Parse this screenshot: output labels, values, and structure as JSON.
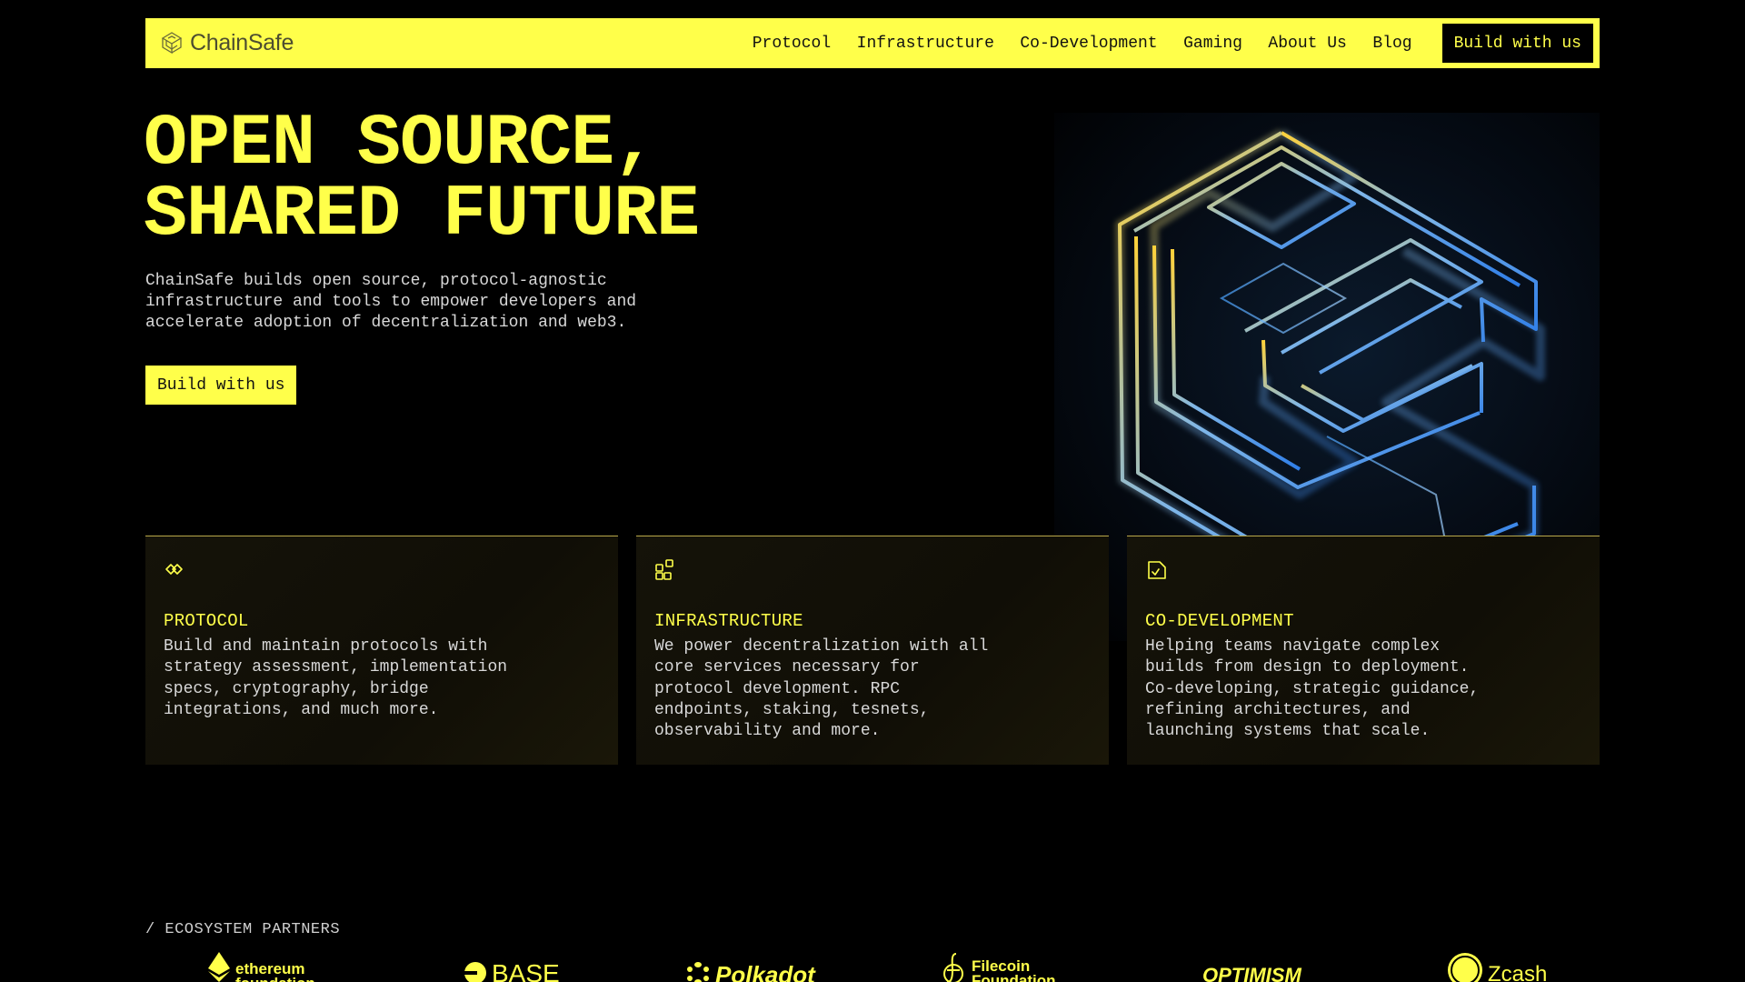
{
  "nav": {
    "brand": "ChainSafe",
    "links": [
      "Protocol",
      "Infrastructure",
      "Co-Development",
      "Gaming",
      "About Us",
      "Blog"
    ],
    "cta": "Build with us"
  },
  "hero": {
    "title_line1": "OPEN SOURCE,",
    "title_line2": "SHARED FUTURE",
    "subtitle": "ChainSafe builds open source, protocol-agnostic infrastructure and tools to empower developers and accelerate adoption of decentralization and web3.",
    "cta": "Build with us",
    "image_icon": "chainsafe-logo-3d-render"
  },
  "cards": [
    {
      "icon": "protocol-icon",
      "title": "PROTOCOL",
      "text": "Build and maintain protocols with strategy assessment, implementation specs, cryptography, bridge integrations, and much more."
    },
    {
      "icon": "infrastructure-icon",
      "title": "INFRASTRUCTURE",
      "text": "We power decentralization with all core services necessary for protocol development. RPC endpoints, staking, tesnets, observability and more."
    },
    {
      "icon": "co-development-icon",
      "title": "CO-DEVELOPMENT",
      "text": "Helping teams navigate complex builds from design to deployment. Co-developing, strategic guidance, refining architectures, and launching systems that scale."
    }
  ],
  "partners": {
    "label": "/ ECOSYSTEM PARTNERS",
    "items": [
      "ethereum foundation",
      "BASE",
      "Polkadot",
      "Filecoin Foundation",
      "OPTIMISM",
      "Zcash"
    ]
  },
  "colors": {
    "accent": "#ffff4a",
    "background": "#000000",
    "card_bg": "#14120a"
  }
}
